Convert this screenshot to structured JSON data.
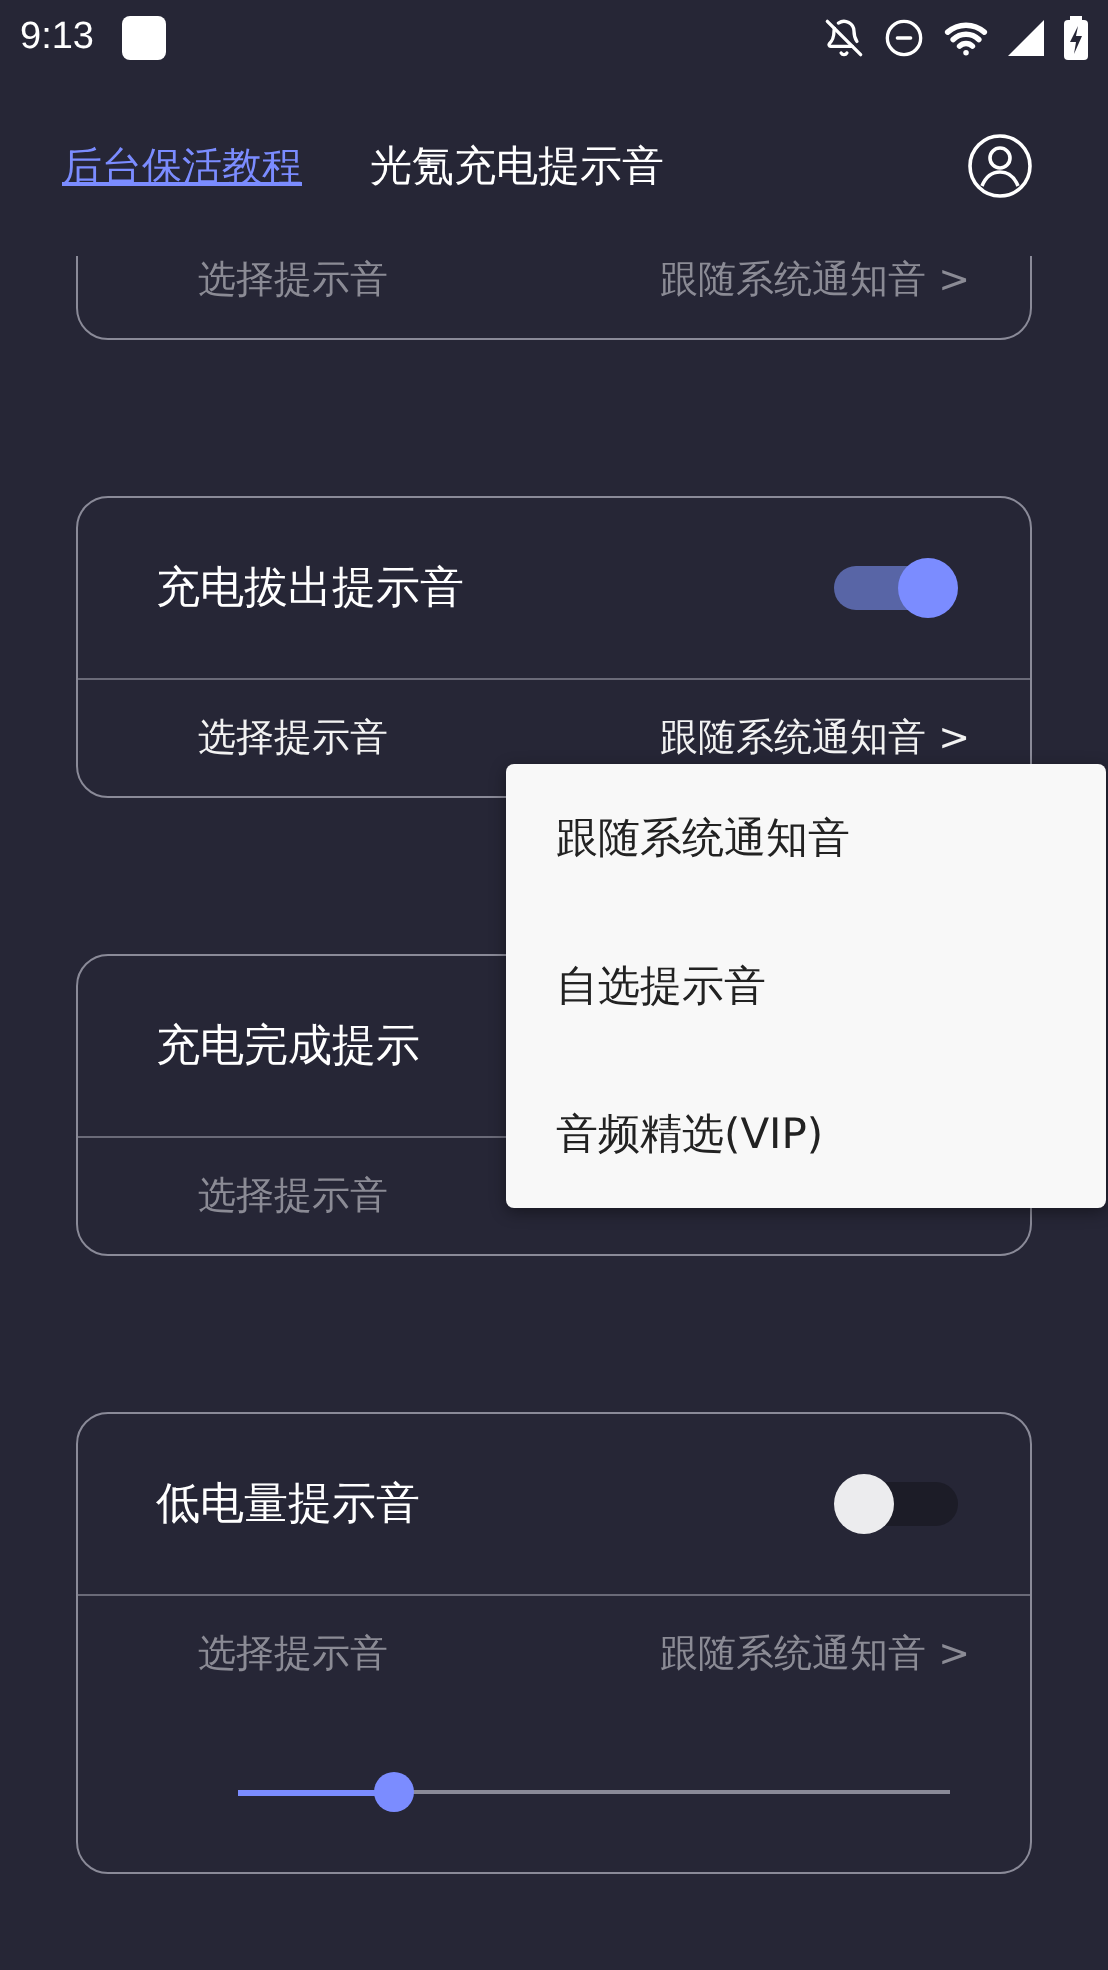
{
  "status_bar": {
    "time": "9:13"
  },
  "header": {
    "link": "后台保活教程",
    "title": "光氪充电提示音"
  },
  "cards": [
    {
      "select": {
        "label": "选择提示音",
        "value": "跟随系统通知音 >",
        "disabled": true
      }
    },
    {
      "title": "充电拔出提示音",
      "toggle": {
        "on": true
      },
      "select": {
        "label": "选择提示音",
        "value": "跟随系统通知音 >",
        "disabled": false
      }
    },
    {
      "title": "充电完成提示",
      "select": {
        "label": "选择提示音",
        "disabled": true
      }
    },
    {
      "title": "低电量提示音",
      "toggle": {
        "on": false
      },
      "select": {
        "label": "选择提示音",
        "value": "跟随系统通知音 >",
        "disabled": true
      },
      "slider": {
        "level": 0.22
      }
    }
  ],
  "menu": {
    "items": [
      "跟随系统通知音",
      "自选提示音",
      "音频精选(VIP)"
    ]
  }
}
